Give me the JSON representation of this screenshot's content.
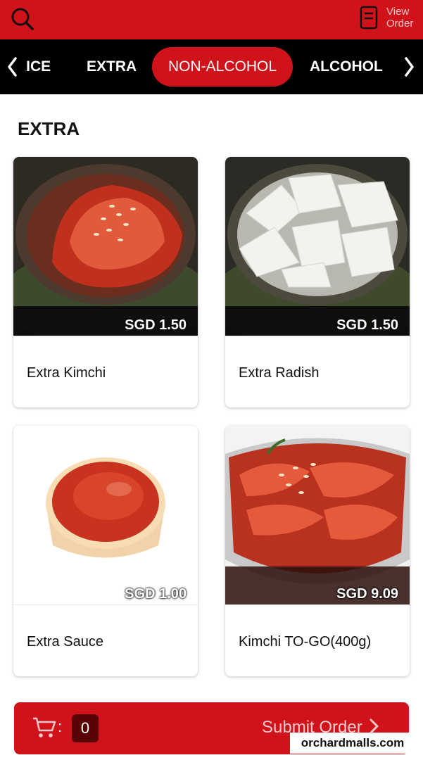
{
  "header": {
    "search_icon": "search-icon",
    "view_order_line1": "View",
    "view_order_line2": "Order",
    "brand_color": "#d0121b"
  },
  "categories": {
    "items": [
      {
        "label": "RICE",
        "active": false
      },
      {
        "label": "EXTRA",
        "active": false
      },
      {
        "label": "NON-ALCOHOL",
        "active": true
      },
      {
        "label": "ALCOHOL",
        "active": false
      }
    ],
    "prev_icon": "chevron-left-icon",
    "next_icon": "chevron-right-icon"
  },
  "section": {
    "title": "EXTRA"
  },
  "products": [
    {
      "name": "Extra Kimchi",
      "price": "SGD 1.50",
      "image": "kimchi-bowl"
    },
    {
      "name": "Extra Radish",
      "price": "SGD 1.50",
      "image": "radish-bowl"
    },
    {
      "name": "Extra Sauce",
      "price": "SGD 1.00",
      "image": "sauce-cup"
    },
    {
      "name": "Kimchi TO-GO(400g)",
      "price": "SGD 9.09",
      "image": "kimchi-container"
    }
  ],
  "footer": {
    "cart_icon": "cart-icon",
    "colon": ":",
    "cart_count": "0",
    "submit_label": "Submit Order"
  },
  "watermark": "orchardmalls.com"
}
